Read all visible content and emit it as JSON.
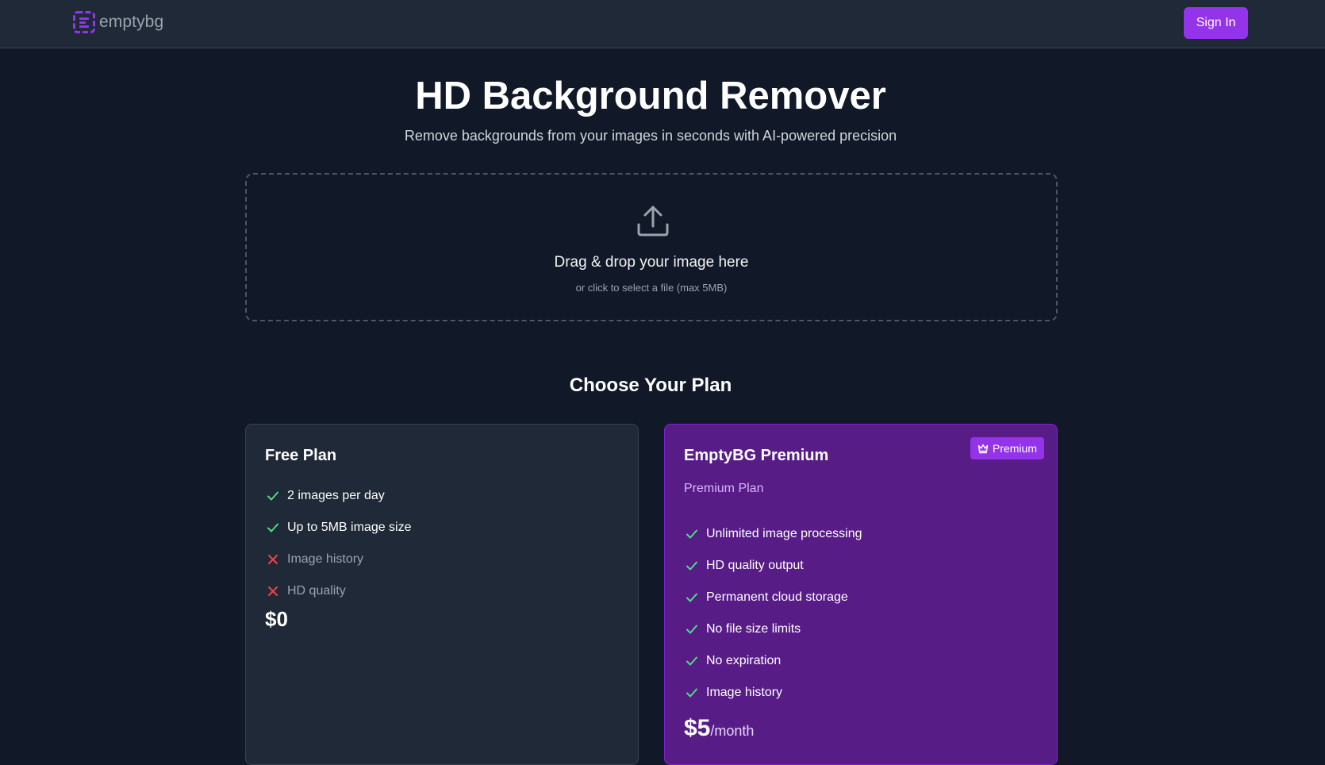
{
  "header": {
    "brand_name": "emptybg",
    "brand_icon": "logo-icon",
    "signin_label": "Sign In",
    "accent": "#9333ea"
  },
  "hero": {
    "title": "HD Background Remover",
    "subtitle": "Remove backgrounds from your images in seconds with AI-powered precision"
  },
  "upload": {
    "icon": "upload-icon",
    "title": "Drag & drop your image here",
    "hint": "or click to select a file (max 5MB)"
  },
  "plans": {
    "heading": "Choose Your Plan",
    "free": {
      "title": "Free Plan",
      "features": [
        {
          "label": "2 images per day",
          "included": true
        },
        {
          "label": "Up to 5MB image size",
          "included": true
        },
        {
          "label": "Image history",
          "included": false
        },
        {
          "label": "HD quality",
          "included": false
        }
      ],
      "price": "$0"
    },
    "premium": {
      "badge": "Premium",
      "badge_icon": "crown-icon",
      "title": "EmptyBG Premium",
      "subtitle": "Premium Plan",
      "features": [
        {
          "label": "Unlimited image processing",
          "included": true
        },
        {
          "label": "HD quality output",
          "included": true
        },
        {
          "label": "Permanent cloud storage",
          "included": true
        },
        {
          "label": "No file size limits",
          "included": true
        },
        {
          "label": "No expiration",
          "included": true
        },
        {
          "label": "Image history",
          "included": true
        }
      ],
      "price": "$5",
      "period": "/month"
    }
  },
  "colors": {
    "page_bg": "#111827",
    "header_bg": "#1f2937",
    "free_card_bg": "#1f2937",
    "premium_card_bg": "#581c87",
    "check": "#4ade80",
    "cross": "#ef4444"
  }
}
